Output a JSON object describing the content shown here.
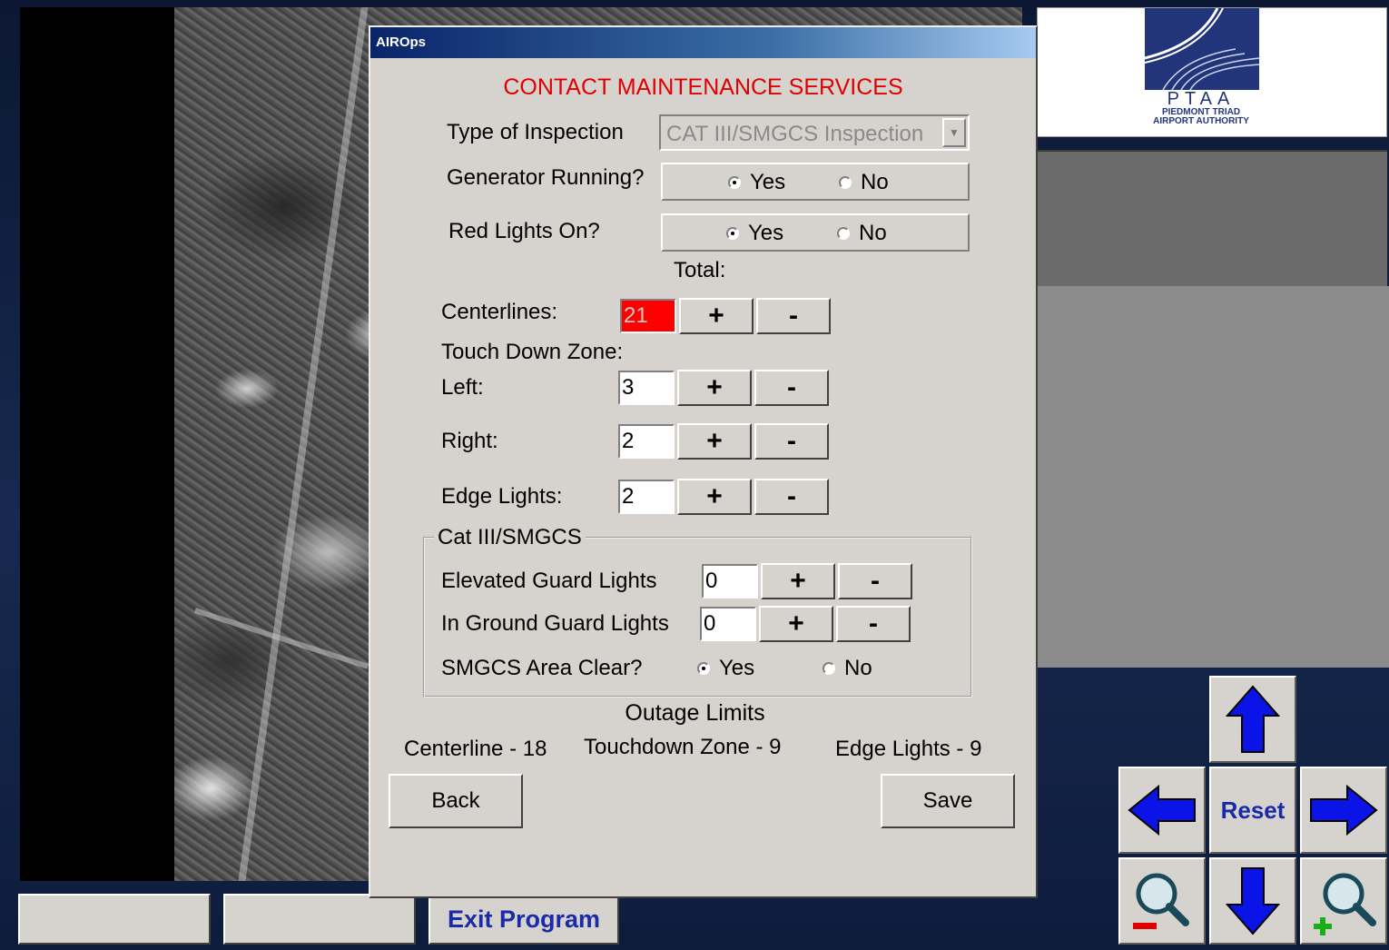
{
  "dialog": {
    "title": "AIROps",
    "heading": "CONTACT MAINTENANCE SERVICES",
    "type_of_inspection": {
      "label": "Type of Inspection",
      "value": "CAT III/SMGCS Inspection"
    },
    "generator_running": {
      "label": "Generator Running?",
      "yes": "Yes",
      "no": "No",
      "selected": "Yes"
    },
    "red_lights_on": {
      "label": "Red Lights On?",
      "yes": "Yes",
      "no": "No",
      "selected": "Yes"
    },
    "total_label": "Total:",
    "centerlines": {
      "label": "Centerlines:",
      "value": "21",
      "plus": "+",
      "minus": "-"
    },
    "touch_down_zone_label": "Touch Down Zone:",
    "left": {
      "label": "Left:",
      "value": "3",
      "plus": "+",
      "minus": "-"
    },
    "right": {
      "label": "Right:",
      "value": "2",
      "plus": "+",
      "minus": "-"
    },
    "edge_lights": {
      "label": "Edge Lights:",
      "value": "2",
      "plus": "+",
      "minus": "-"
    },
    "cat_group": {
      "legend": "Cat III/SMGCS",
      "elevated_guard_lights": {
        "label": "Elevated Guard Lights",
        "value": "0",
        "plus": "+",
        "minus": "-"
      },
      "in_ground_guard_lights": {
        "label": "In Ground Guard Lights",
        "value": "0",
        "plus": "+",
        "minus": "-"
      },
      "smgcs_area_clear": {
        "label": "SMGCS Area Clear?",
        "yes": "Yes",
        "no": "No",
        "selected": "Yes"
      }
    },
    "outage_limits": {
      "title": "Outage Limits",
      "centerline": "Centerline - 18",
      "touchdown_zone": "Touchdown Zone - 9",
      "edge_lights": "Edge Lights - 9"
    },
    "back_label": "Back",
    "save_label": "Save"
  },
  "logo": {
    "abbr": "PTAA",
    "line1": "PIEDMONT TRIAD",
    "line2": "AIRPORT AUTHORITY"
  },
  "nav": {
    "reset_label": "Reset"
  },
  "bottom_bar": {
    "exit_label": "Exit Program"
  },
  "colors": {
    "accent_blue": "#1a2aa8",
    "alert_red": "#e00000",
    "dialog_bg": "#d6d3ce"
  }
}
